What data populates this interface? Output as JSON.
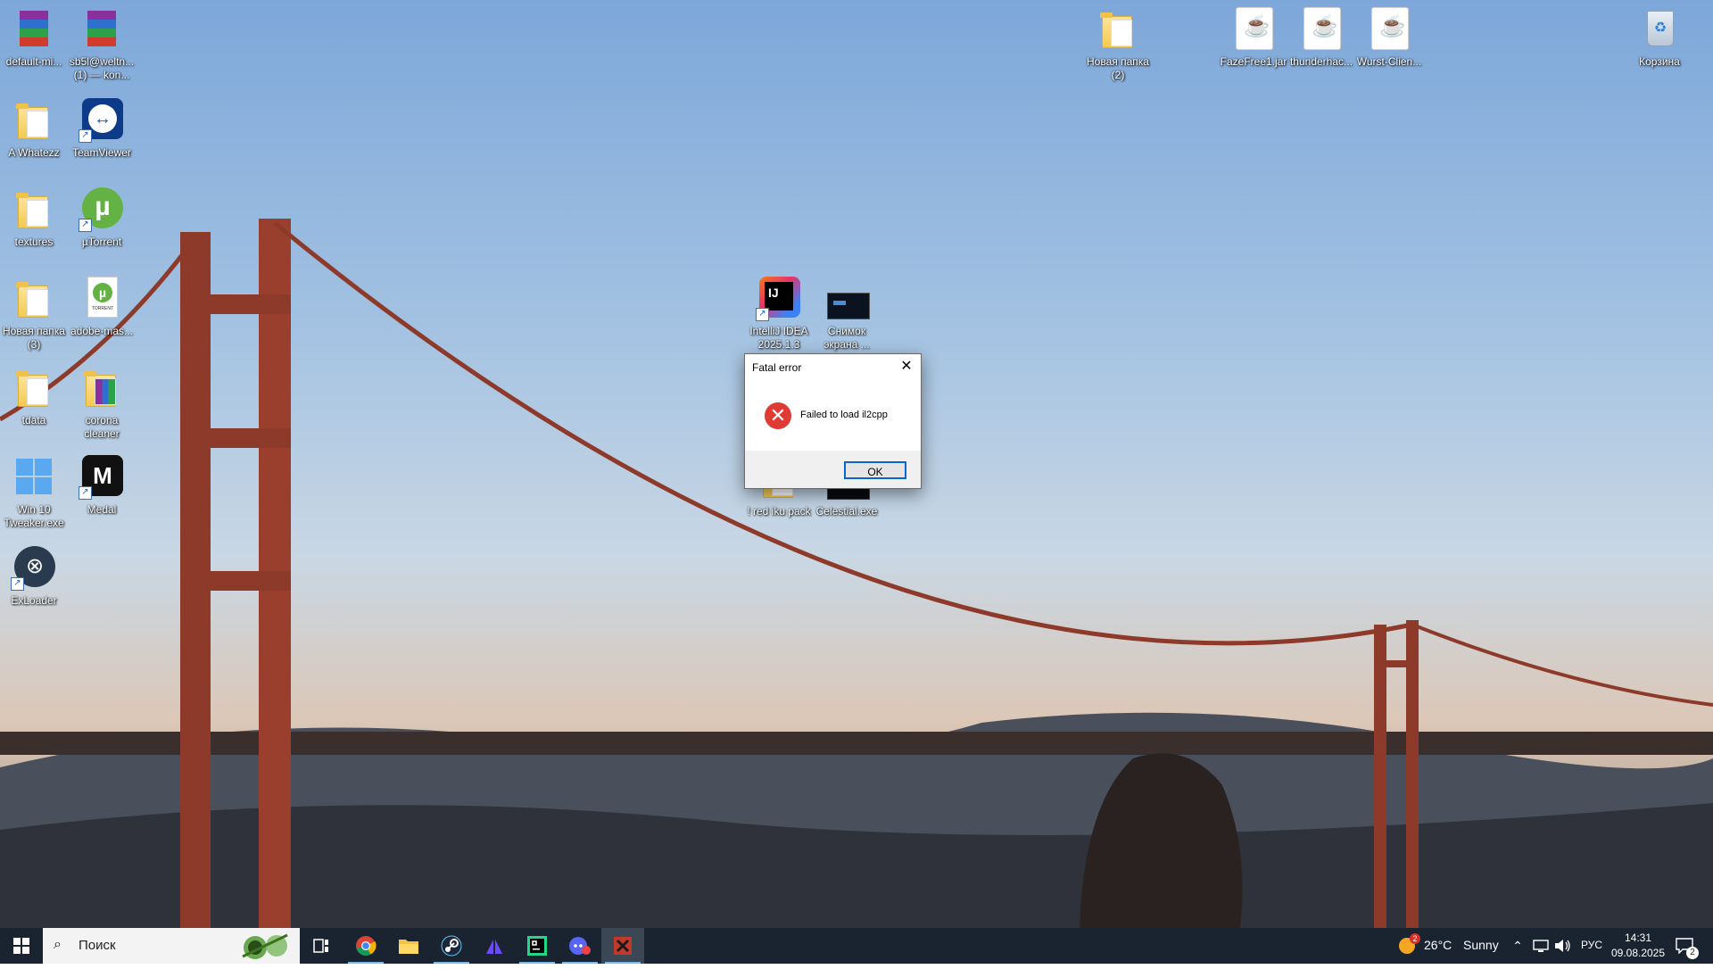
{
  "desktop": {
    "icons": [
      {
        "label": "default-mi..."
      },
      {
        "label": "sb5l@weltn...\n(1) — kon..."
      },
      {
        "label": "A Whatezz"
      },
      {
        "label": "TeamViewer"
      },
      {
        "label": "textures"
      },
      {
        "label": "µTorrent"
      },
      {
        "label": "Новая папка\n(3)"
      },
      {
        "label": "adobe-mas..."
      },
      {
        "label": "tdata"
      },
      {
        "label": "corona\ncleaner"
      },
      {
        "label": "Win 10\nTweaker.exe"
      },
      {
        "label": "Medal"
      },
      {
        "label": "ExLoader"
      },
      {
        "label": "Новая папка\n(2)"
      },
      {
        "label": "FazeFree1.jar"
      },
      {
        "label": "thunderhac..."
      },
      {
        "label": "Wurst-Clien..."
      },
      {
        "label": "Корзина"
      },
      {
        "label": "IntelliJ IDEA\n2025.1.3"
      },
      {
        "label": "Снимок\nэкрана ..."
      },
      {
        "label": "! red iku pack"
      },
      {
        "label": "Celestial.exe"
      }
    ]
  },
  "dialog": {
    "title": "Fatal error",
    "message": "Failed to load il2cpp",
    "ok_label": "OK",
    "close_glyph": "✕",
    "error_glyph": "✕"
  },
  "taskbar": {
    "search_placeholder": "Поиск",
    "weather_temp": "26°C",
    "weather_condition": "Sunny",
    "weather_badge": "2",
    "language": "РУС",
    "time": "14:31",
    "date": "09.08.2025",
    "notification_count": "2"
  },
  "colors": {
    "taskbar_bg": "#1a2330",
    "accent": "#0a64d6",
    "error_red": "#e03a34"
  }
}
